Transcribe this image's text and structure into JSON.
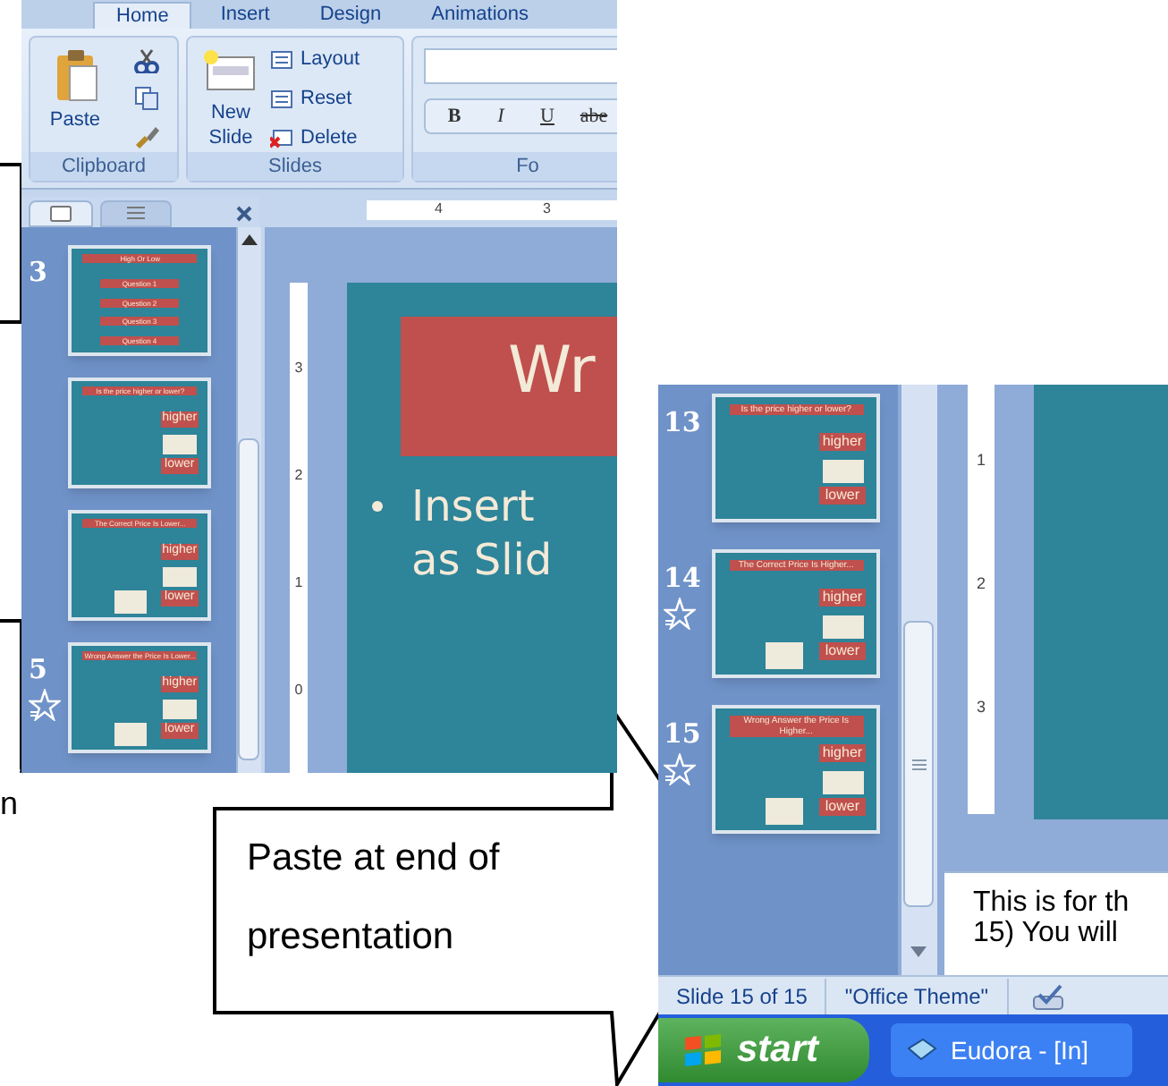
{
  "left_callout": {
    "text": "n"
  },
  "left_screenshot": {
    "ribbon": {
      "tabs": [
        {
          "label": "Home",
          "selected": true
        },
        {
          "label": "Insert",
          "selected": false
        },
        {
          "label": "Design",
          "selected": false
        },
        {
          "label": "Animations",
          "selected": false
        }
      ],
      "groups": [
        {
          "kind": "clipboard",
          "label": "Clipboard",
          "buttons": [
            "Paste"
          ]
        },
        {
          "kind": "slides",
          "label": "Slides",
          "buttons": [
            "New\nSlide",
            "Layout",
            "Reset",
            "Delete"
          ]
        },
        {
          "kind": "font",
          "label": "Fo",
          "buttons": [
            "B",
            "I",
            "U",
            "abe"
          ]
        }
      ]
    },
    "thumbnails": [
      {
        "number": "3",
        "animated": false,
        "kind": "menu",
        "title": "High Or Low",
        "items": [
          "Question 1",
          "Question 2",
          "Question 3",
          "Question 4"
        ]
      },
      {
        "animated": false,
        "kind": "question",
        "title": "Is the price higher or lower?",
        "higher": "higher",
        "lower": "lower",
        "extra_note": false
      },
      {
        "animated": false,
        "kind": "question",
        "title": "The Correct Price Is Lower...",
        "higher": "higher",
        "lower": "lower",
        "extra_note": true
      },
      {
        "number": "5",
        "animated": true,
        "kind": "question",
        "title": "Wrong Answer the Price Is Lower...",
        "higher": "higher",
        "lower": "lower",
        "extra_note": true
      }
    ],
    "ruler_labels": [
      "4",
      "3"
    ],
    "vertical_ruler_labels": [
      "3",
      "2",
      "1",
      "0"
    ],
    "slide": {
      "title": "Wr",
      "bullet_lines": [
        "Insert",
        "as Slid"
      ]
    }
  },
  "right_callout": {
    "text": "Paste at end of presentation"
  },
  "right_screenshot": {
    "thumbnails": [
      {
        "number": "13",
        "animated": false,
        "kind": "question",
        "title": "Is the price higher or lower?",
        "higher": "higher",
        "lower": "lower",
        "extra_note": false
      },
      {
        "number": "14",
        "animated": true,
        "kind": "question",
        "title": "The Correct Price Is Higher...",
        "higher": "higher",
        "lower": "lower",
        "extra_note": true
      },
      {
        "number": "15",
        "animated": true,
        "kind": "question",
        "title": "Wrong Answer the Price Is Higher...",
        "higher": "higher",
        "lower": "lower",
        "extra_note": true
      }
    ],
    "vertical_ruler_labels": [
      "1",
      "2",
      "3"
    ],
    "notes": [
      "This is for th",
      "15) You will"
    ],
    "status_bar": [
      "Slide 15 of 15",
      "\"Office Theme\""
    ],
    "taskbar": {
      "start": "start",
      "tasks": [
        "Eudora - [In]"
      ]
    }
  }
}
